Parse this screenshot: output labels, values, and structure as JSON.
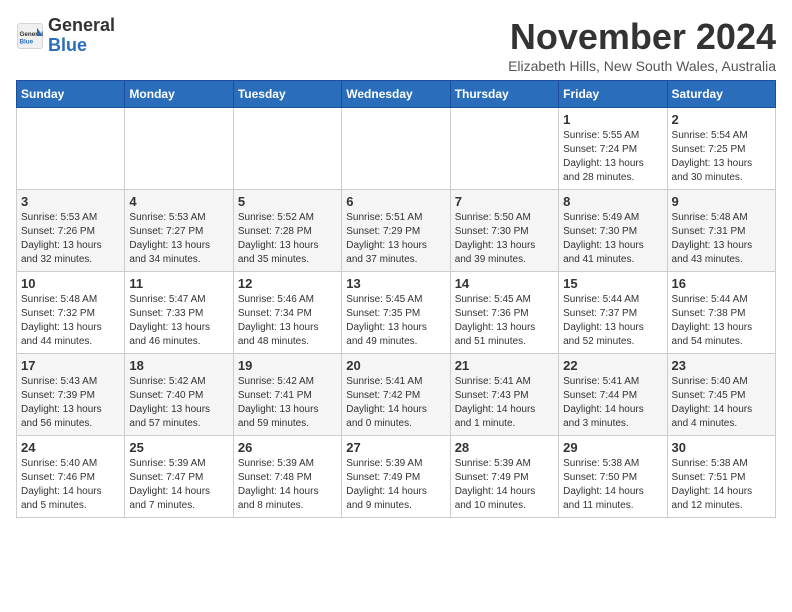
{
  "header": {
    "logo_general": "General",
    "logo_blue": "Blue",
    "month_title": "November 2024",
    "subtitle": "Elizabeth Hills, New South Wales, Australia"
  },
  "calendar": {
    "days_of_week": [
      "Sunday",
      "Monday",
      "Tuesday",
      "Wednesday",
      "Thursday",
      "Friday",
      "Saturday"
    ],
    "weeks": [
      [
        {
          "day": "",
          "info": ""
        },
        {
          "day": "",
          "info": ""
        },
        {
          "day": "",
          "info": ""
        },
        {
          "day": "",
          "info": ""
        },
        {
          "day": "",
          "info": ""
        },
        {
          "day": "1",
          "info": "Sunrise: 5:55 AM\nSunset: 7:24 PM\nDaylight: 13 hours\nand 28 minutes."
        },
        {
          "day": "2",
          "info": "Sunrise: 5:54 AM\nSunset: 7:25 PM\nDaylight: 13 hours\nand 30 minutes."
        }
      ],
      [
        {
          "day": "3",
          "info": "Sunrise: 5:53 AM\nSunset: 7:26 PM\nDaylight: 13 hours\nand 32 minutes."
        },
        {
          "day": "4",
          "info": "Sunrise: 5:53 AM\nSunset: 7:27 PM\nDaylight: 13 hours\nand 34 minutes."
        },
        {
          "day": "5",
          "info": "Sunrise: 5:52 AM\nSunset: 7:28 PM\nDaylight: 13 hours\nand 35 minutes."
        },
        {
          "day": "6",
          "info": "Sunrise: 5:51 AM\nSunset: 7:29 PM\nDaylight: 13 hours\nand 37 minutes."
        },
        {
          "day": "7",
          "info": "Sunrise: 5:50 AM\nSunset: 7:30 PM\nDaylight: 13 hours\nand 39 minutes."
        },
        {
          "day": "8",
          "info": "Sunrise: 5:49 AM\nSunset: 7:30 PM\nDaylight: 13 hours\nand 41 minutes."
        },
        {
          "day": "9",
          "info": "Sunrise: 5:48 AM\nSunset: 7:31 PM\nDaylight: 13 hours\nand 43 minutes."
        }
      ],
      [
        {
          "day": "10",
          "info": "Sunrise: 5:48 AM\nSunset: 7:32 PM\nDaylight: 13 hours\nand 44 minutes."
        },
        {
          "day": "11",
          "info": "Sunrise: 5:47 AM\nSunset: 7:33 PM\nDaylight: 13 hours\nand 46 minutes."
        },
        {
          "day": "12",
          "info": "Sunrise: 5:46 AM\nSunset: 7:34 PM\nDaylight: 13 hours\nand 48 minutes."
        },
        {
          "day": "13",
          "info": "Sunrise: 5:45 AM\nSunset: 7:35 PM\nDaylight: 13 hours\nand 49 minutes."
        },
        {
          "day": "14",
          "info": "Sunrise: 5:45 AM\nSunset: 7:36 PM\nDaylight: 13 hours\nand 51 minutes."
        },
        {
          "day": "15",
          "info": "Sunrise: 5:44 AM\nSunset: 7:37 PM\nDaylight: 13 hours\nand 52 minutes."
        },
        {
          "day": "16",
          "info": "Sunrise: 5:44 AM\nSunset: 7:38 PM\nDaylight: 13 hours\nand 54 minutes."
        }
      ],
      [
        {
          "day": "17",
          "info": "Sunrise: 5:43 AM\nSunset: 7:39 PM\nDaylight: 13 hours\nand 56 minutes."
        },
        {
          "day": "18",
          "info": "Sunrise: 5:42 AM\nSunset: 7:40 PM\nDaylight: 13 hours\nand 57 minutes."
        },
        {
          "day": "19",
          "info": "Sunrise: 5:42 AM\nSunset: 7:41 PM\nDaylight: 13 hours\nand 59 minutes."
        },
        {
          "day": "20",
          "info": "Sunrise: 5:41 AM\nSunset: 7:42 PM\nDaylight: 14 hours\nand 0 minutes."
        },
        {
          "day": "21",
          "info": "Sunrise: 5:41 AM\nSunset: 7:43 PM\nDaylight: 14 hours\nand 1 minute."
        },
        {
          "day": "22",
          "info": "Sunrise: 5:41 AM\nSunset: 7:44 PM\nDaylight: 14 hours\nand 3 minutes."
        },
        {
          "day": "23",
          "info": "Sunrise: 5:40 AM\nSunset: 7:45 PM\nDaylight: 14 hours\nand 4 minutes."
        }
      ],
      [
        {
          "day": "24",
          "info": "Sunrise: 5:40 AM\nSunset: 7:46 PM\nDaylight: 14 hours\nand 5 minutes."
        },
        {
          "day": "25",
          "info": "Sunrise: 5:39 AM\nSunset: 7:47 PM\nDaylight: 14 hours\nand 7 minutes."
        },
        {
          "day": "26",
          "info": "Sunrise: 5:39 AM\nSunset: 7:48 PM\nDaylight: 14 hours\nand 8 minutes."
        },
        {
          "day": "27",
          "info": "Sunrise: 5:39 AM\nSunset: 7:49 PM\nDaylight: 14 hours\nand 9 minutes."
        },
        {
          "day": "28",
          "info": "Sunrise: 5:39 AM\nSunset: 7:49 PM\nDaylight: 14 hours\nand 10 minutes."
        },
        {
          "day": "29",
          "info": "Sunrise: 5:38 AM\nSunset: 7:50 PM\nDaylight: 14 hours\nand 11 minutes."
        },
        {
          "day": "30",
          "info": "Sunrise: 5:38 AM\nSunset: 7:51 PM\nDaylight: 14 hours\nand 12 minutes."
        }
      ]
    ]
  }
}
